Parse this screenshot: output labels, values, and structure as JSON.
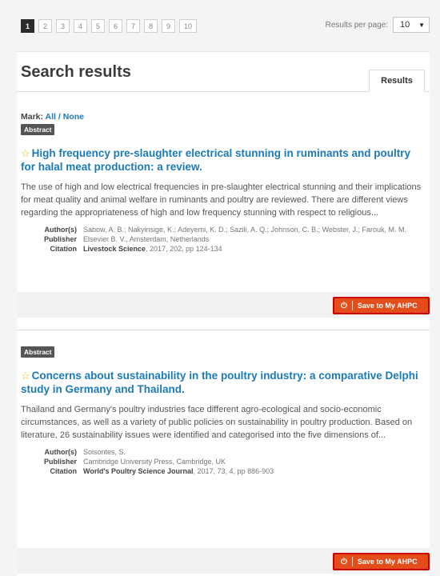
{
  "pagination": {
    "pages": [
      "1",
      "2",
      "3",
      "4",
      "5",
      "6",
      "7",
      "8",
      "9",
      "10"
    ],
    "active_page": "1",
    "results_per_page_label": "Results per page:",
    "results_per_page_value": "10"
  },
  "header": {
    "title": "Search results",
    "tab_label": "Results"
  },
  "mark": {
    "label": "Mark:",
    "all": "All",
    "separator": "/",
    "none": "None"
  },
  "results": [
    {
      "badge": "Abstract",
      "title": "High frequency pre-slaughter electrical stunning in ruminants and poultry for halal meat production: a review.",
      "abstract": "The use of high and low electrical frequencies in pre-slaughter electrical stunning and their implications for meat quality and animal welfare in ruminants and poultry are reviewed. There are different views regarding the appropriateness of high and low frequency stunning with respect to religious...",
      "authors_label": "Author(s)",
      "authors": "Sabow, A. B.; Nakyinsige, K.; Adeyemi, K. D.; Sazili, A. Q.; Johnson, C. B.; Webster, J.; Farouk, M. M.",
      "publisher_label": "Publisher",
      "publisher": "Elsevier B. V., Amsterdam, Netherlands",
      "citation_label": "Citation",
      "citation_journal": "Livestock Science",
      "citation_rest": ", 2017, 202, pp 124-134",
      "save_label": "Save to My AHPC"
    },
    {
      "badge": "Abstract",
      "title": "Concerns about sustainability in the poultry industry: a comparative Delphi study in Germany and Thailand.",
      "abstract": "Thailand and Germany's poultry industries face different agro-ecological and socio-economic circumstances, as well as a variety of public policies on sustainability in poultry production. Based on literature, 26 sustainability issues were identified and categorised into the five dimensions of...",
      "authors_label": "Author(s)",
      "authors": "Soisontes, S.",
      "publisher_label": "Publisher",
      "publisher": "Cambridge University Press, Cambridge, UK",
      "citation_label": "Citation",
      "citation_journal": "World's Poultry Science Journal",
      "citation_rest": ", 2017, 73, 4, pp 886-903",
      "save_label": "Save to My AHPC"
    }
  ],
  "colors": {
    "link": "#1b7bb8",
    "save_button": "#e44d1a",
    "save_button_highlight": "#c80000",
    "star": "#e8b400"
  }
}
